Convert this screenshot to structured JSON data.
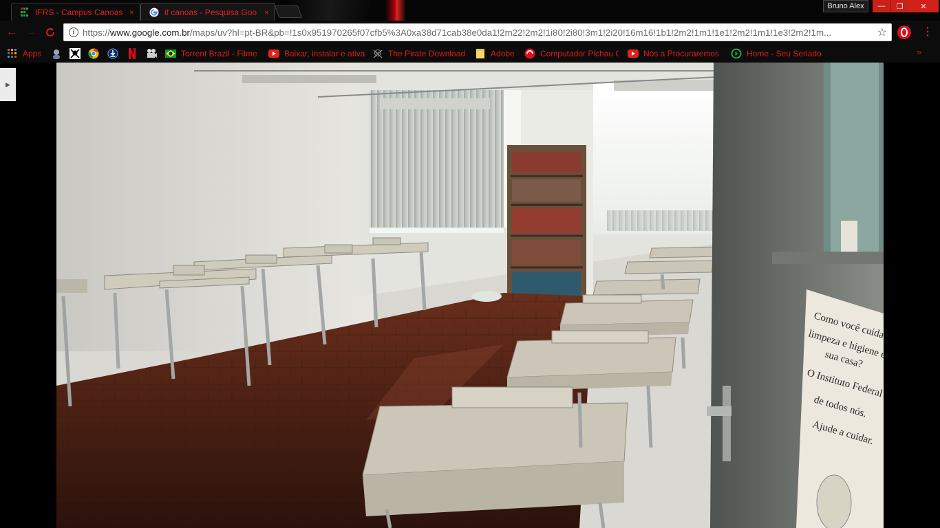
{
  "window": {
    "user_name": "Bruno Alex",
    "buttons": {
      "minimize": "—",
      "maximize": "❐",
      "close": "✕"
    }
  },
  "tabs": [
    {
      "title": "IFRS - Campus Canoas",
      "favicon": "ifrs-grid-icon",
      "active": false,
      "close": "×"
    },
    {
      "title": "if canoas - Pesquisa Goo",
      "favicon": "google-icon",
      "active": true,
      "close": "×"
    }
  ],
  "toolbar": {
    "back": "←",
    "forward": "→",
    "reload": "C",
    "url_prefix": "https://",
    "url_host": "www.google.com.br",
    "url_path": "/maps/uv?hl=pt-BR&pb=!1s0x951970265f07cfb5%3A0xa38d71cab38e0da1!2m22!2m2!1i80!2i80!3m1!2i20!16m16!1b1!2m2!1m1!1e1!2m2!1m1!1e3!2m2!1m...",
    "star": "☆",
    "menu": "⋮"
  },
  "bookmarks": [
    {
      "icon": "apps-grid-icon",
      "label": "Apps"
    },
    {
      "icon": "avatar-icon",
      "label": ""
    },
    {
      "icon": "pirate-flag-icon",
      "label": ""
    },
    {
      "icon": "chrome-color-icon",
      "label": ""
    },
    {
      "icon": "download-circle-icon",
      "label": ""
    },
    {
      "icon": "netflix-icon",
      "label": ""
    },
    {
      "icon": "film-camera-icon",
      "label": ""
    },
    {
      "icon": "brazil-flag-icon",
      "label": "Torrent Brazil - Filme"
    },
    {
      "icon": "youtube-icon",
      "label": "Baixar, instalar e ativa"
    },
    {
      "icon": "pirate-skull-icon",
      "label": "The Pirate Download"
    },
    {
      "icon": "folder-icon",
      "label": "Adobe"
    },
    {
      "icon": "pichau-icon",
      "label": "Computador Pichau G"
    },
    {
      "icon": "youtube-icon",
      "label": "Nós a Procuraremos"
    },
    {
      "icon": "play-green-icon",
      "label": "Home - Seu Seriado"
    }
  ],
  "bookmarks_more": "»",
  "content": {
    "side_toggle": "▶",
    "poster_lines": [
      "Como você cuida d",
      "limpeza e higiene e",
      "sua casa?",
      "O Instituto Federal",
      "de todos nós.",
      "Ajude a cuidar."
    ]
  },
  "colors": {
    "accent": "#e01a1a",
    "titlebar": "#050505",
    "toolbar": "#0c0c0c",
    "window_buttons": "#c9201a"
  }
}
